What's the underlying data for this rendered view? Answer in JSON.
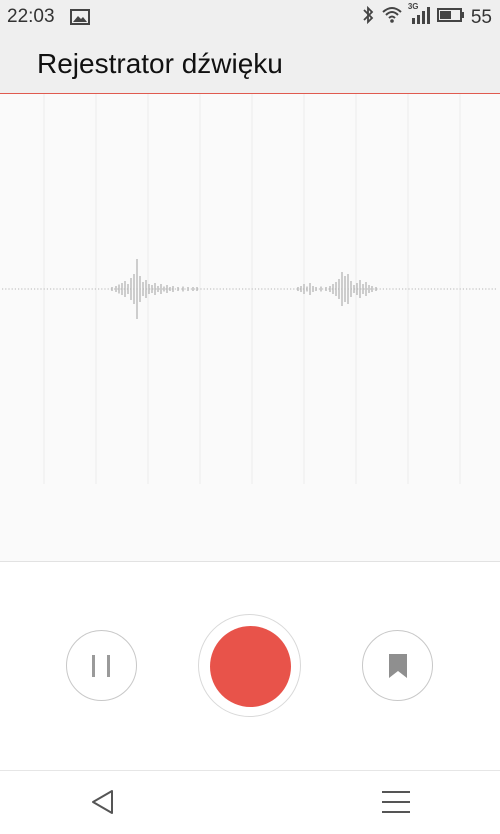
{
  "status_bar": {
    "time": "22:03",
    "network_label": "3G",
    "battery_level": "55",
    "icons": [
      "image-icon",
      "bluetooth-icon",
      "wifi-icon",
      "signal-icon",
      "battery-icon"
    ]
  },
  "app": {
    "title": "Rejestrator dźwięku"
  },
  "colors": {
    "accent": "#e8534a",
    "header_bg": "#efefef",
    "wave_bg": "#fafafa",
    "wave_stroke": "#b5b5b5"
  },
  "controls": {
    "pause_icon": "pause-icon",
    "record_icon": "record-icon",
    "bookmark_icon": "bookmark-icon"
  },
  "nav": {
    "back_icon": "back-triangle-icon",
    "menu_icon": "menu-icon"
  }
}
